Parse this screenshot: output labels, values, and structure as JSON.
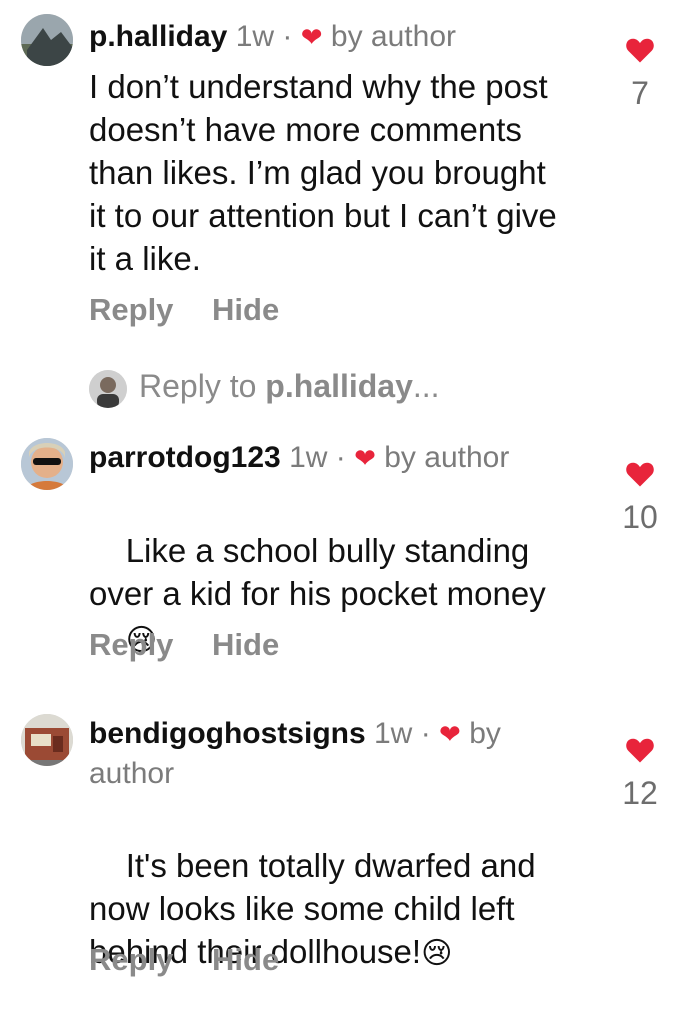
{
  "comments": [
    {
      "username": "p.halliday",
      "time": "1w",
      "sep": "·",
      "by_author": "by author",
      "text": "I don’t understand why the post\ndoesn’t have more comments\nthan likes. I’m glad you brought\nit to our attention but I can’t give\nit a like.",
      "likes": "7",
      "reply_label": "Reply",
      "hide_label": "Hide"
    },
    {
      "username": "parrotdog123",
      "time": "1w",
      "sep": "·",
      "by_author": "by author",
      "text": "Like a school bully standing\nover a kid for his pocket money",
      "emoji": "😢",
      "likes": "10",
      "reply_label": "Reply",
      "hide_label": "Hide"
    },
    {
      "username": "bendigoghostsigns",
      "time": "1w",
      "sep": "·",
      "by_author_1": "by",
      "by_author_2": "author",
      "text": "It's been totally dwarfed and\nnow looks like some child left\nbehind their dollhouse!",
      "emoji": "😢",
      "likes": "12",
      "reply_label": "Reply",
      "hide_label": "Hide"
    }
  ],
  "reply_prompt": {
    "prefix": "Reply to ",
    "target": "p.halliday",
    "suffix": "..."
  },
  "colors": {
    "heart": "#e8243b",
    "muted": "#8a8a8a",
    "text": "#111111"
  }
}
